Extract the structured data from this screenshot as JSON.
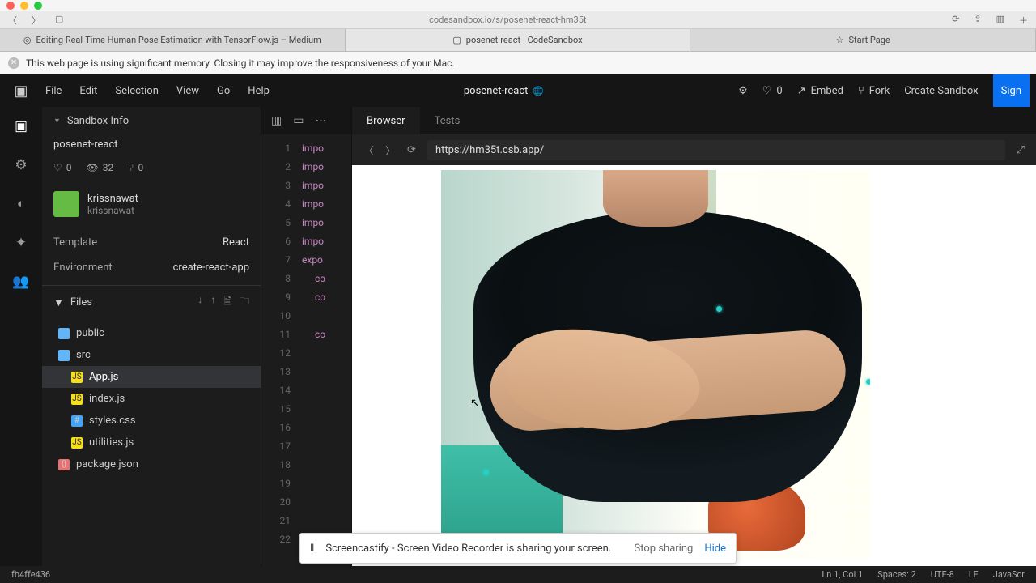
{
  "mac": {
    "url": "codesandbox.io/s/posenet-react-hm35t"
  },
  "browser_tabs": [
    "Editing Real-Time Human Pose Estimation with TensorFlow.js – Medium",
    "posenet-react - CodeSandbox",
    "Start Page"
  ],
  "memory_banner": "This web page is using significant memory. Closing it may improve the responsiveness of your Mac.",
  "menus": {
    "file": "File",
    "edit": "Edit",
    "selection": "Selection",
    "view": "View",
    "go": "Go",
    "help": "Help"
  },
  "project_title": "posenet-react",
  "header_actions": {
    "likes": "0",
    "embed": "Embed",
    "fork": "Fork",
    "create": "Create Sandbox",
    "sign": "Sign"
  },
  "sidebar": {
    "info_header": "Sandbox Info",
    "project": "posenet-react",
    "stats": {
      "likes": "0",
      "views": "32",
      "forks": "0"
    },
    "author": {
      "name": "krissnawat",
      "sub": "krissnawat"
    },
    "template_k": "Template",
    "template_v": "React",
    "env_k": "Environment",
    "env_v": "create-react-app",
    "files_header": "Files",
    "tree": {
      "public": "public",
      "src": "src",
      "app": "App.js",
      "index": "index.js",
      "styles": "styles.css",
      "util": "utilities.js",
      "pkg": "package.json"
    }
  },
  "editor": {
    "lines": [
      "1",
      "2",
      "3",
      "4",
      "5",
      "6",
      "7",
      "8",
      "9",
      "10",
      "11",
      "12",
      "13",
      "14",
      "15",
      "16",
      "17",
      "18",
      "19",
      "20",
      "21",
      "22"
    ],
    "tokens": [
      "impo",
      "impo",
      "impo",
      "impo",
      "impo",
      "impo",
      "expo",
      "co",
      "co",
      "",
      "co",
      "",
      "",
      "",
      "",
      "",
      "",
      "",
      "",
      "",
      "",
      ""
    ]
  },
  "preview": {
    "tabs": {
      "browser": "Browser",
      "tests": "Tests"
    },
    "url": "https://hm35t.csb.app/"
  },
  "sharebar": {
    "msg": "Screencastify - Screen Video Recorder is sharing your screen.",
    "stop": "Stop sharing",
    "hide": "Hide"
  },
  "status": {
    "commit": "fb4ffe436",
    "pos": "Ln 1, Col 1",
    "spaces": "Spaces: 2",
    "enc": "UTF-8",
    "eol": "LF",
    "lang": "JavaScr"
  }
}
